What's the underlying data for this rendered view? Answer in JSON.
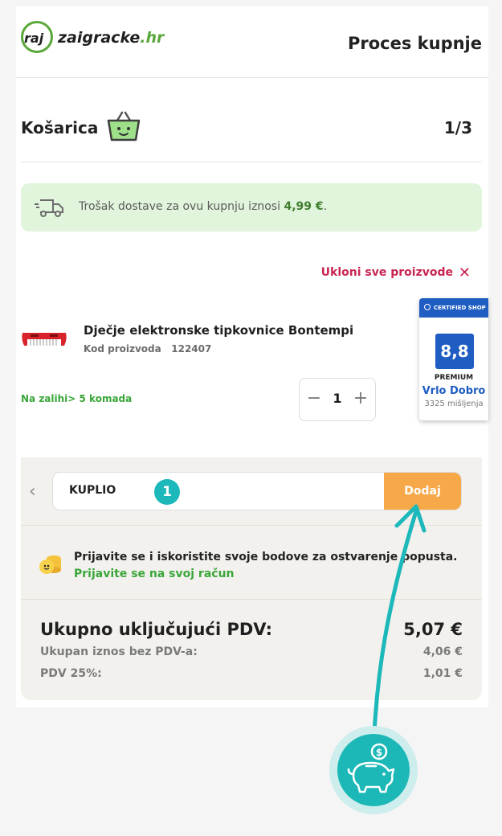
{
  "header": {
    "logo_prefix": "raj",
    "logo_site": "zaigracke",
    "logo_tld": ".hr",
    "title": "Proces kupnje"
  },
  "cart": {
    "title": "Košarica",
    "step": "1/3"
  },
  "shipping": {
    "text": "Trošak dostave za ovu kupnju iznosi ",
    "price": "4,99 €",
    "suffix": "."
  },
  "remove_all_label": "Ukloni sve proizvode",
  "product": {
    "name": "Dječje elektronske tipkovnice Bontempi",
    "code_label": "Kod proizvoda",
    "code": "122407",
    "stock": "Na zalihi> 5 komada",
    "quantity": "1"
  },
  "trust_badge": {
    "header": "CERTIFIED SHOP",
    "score": "8,8",
    "level": "PREMIUM",
    "rating": "Vrlo Dobro",
    "reviews": "3325 mišljenja"
  },
  "coupon": {
    "value": "KUPLIO",
    "step_number": "1",
    "add_label": "Dodaj"
  },
  "login": {
    "text": "Prijavite se i iskoristite svoje bodove za ostvarenje popusta.",
    "link": "Prijavite se na svoj račun"
  },
  "totals": {
    "total_label": "Ukupno uključujući PDV:",
    "total_value": "5,07 €",
    "net_label": "Ukupan iznos bez PDV-a:",
    "net_value": "4,06 €",
    "vat_label": "PDV 25%:",
    "vat_value": "1,01 €"
  },
  "colors": {
    "brand_green": "#5aa83a",
    "accent_teal": "#1db8ba",
    "add_orange": "#f7a94a",
    "remove_red": "#c8254f",
    "badge_blue": "#1f5dc2"
  }
}
